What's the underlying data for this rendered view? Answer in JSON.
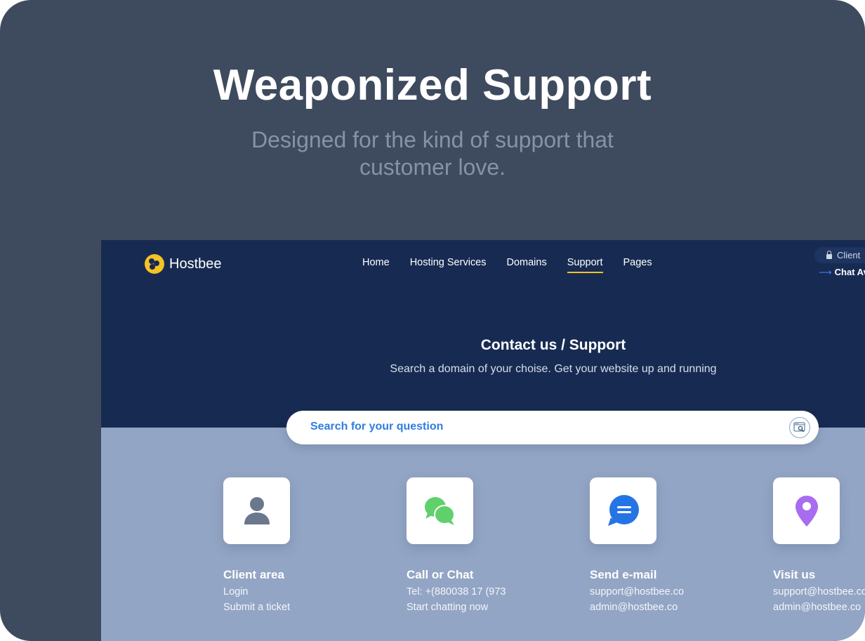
{
  "promo": {
    "title": "Weaponized Support",
    "subtitle": "Designed for the kind of support that customer love."
  },
  "site": {
    "brand": "Hostbee",
    "nav": [
      {
        "label": "Home",
        "active": false
      },
      {
        "label": "Hosting Services",
        "active": false
      },
      {
        "label": "Domains",
        "active": false
      },
      {
        "label": "Support",
        "active": true
      },
      {
        "label": "Pages",
        "active": false
      }
    ],
    "client_login": "Client",
    "chat_status": "Chat Av"
  },
  "hero": {
    "title": "Contact us / Support",
    "subtitle": "Search a domain of your choise. Get your website up and running"
  },
  "search": {
    "placeholder": "Search for your question"
  },
  "cards": [
    {
      "icon": "user-icon",
      "title": "Client area",
      "lines": [
        "Login",
        "Submit a ticket"
      ]
    },
    {
      "icon": "chat-icon",
      "title": "Call or Chat",
      "lines": [
        "Tel: +(880038 17 (973",
        "Start chatting now"
      ]
    },
    {
      "icon": "email-icon",
      "title": "Send e-mail",
      "lines": [
        "support@hostbee.co",
        "admin@hostbee.co"
      ]
    },
    {
      "icon": "location-pin-icon",
      "title": "Visit us",
      "lines": [
        "support@hostbee.co",
        "admin@hostbee.co"
      ]
    }
  ],
  "colors": {
    "frame_bg": "#3e4a5e",
    "header_bg": "#172b52",
    "section_bg": "#93a5c4",
    "accent_yellow": "#f6c324",
    "link_blue": "#2f7de1",
    "chat_green": "#5fd06a",
    "mail_blue": "#2574e6",
    "pin_purple": "#a86cf0",
    "user_gray": "#6a778c"
  }
}
